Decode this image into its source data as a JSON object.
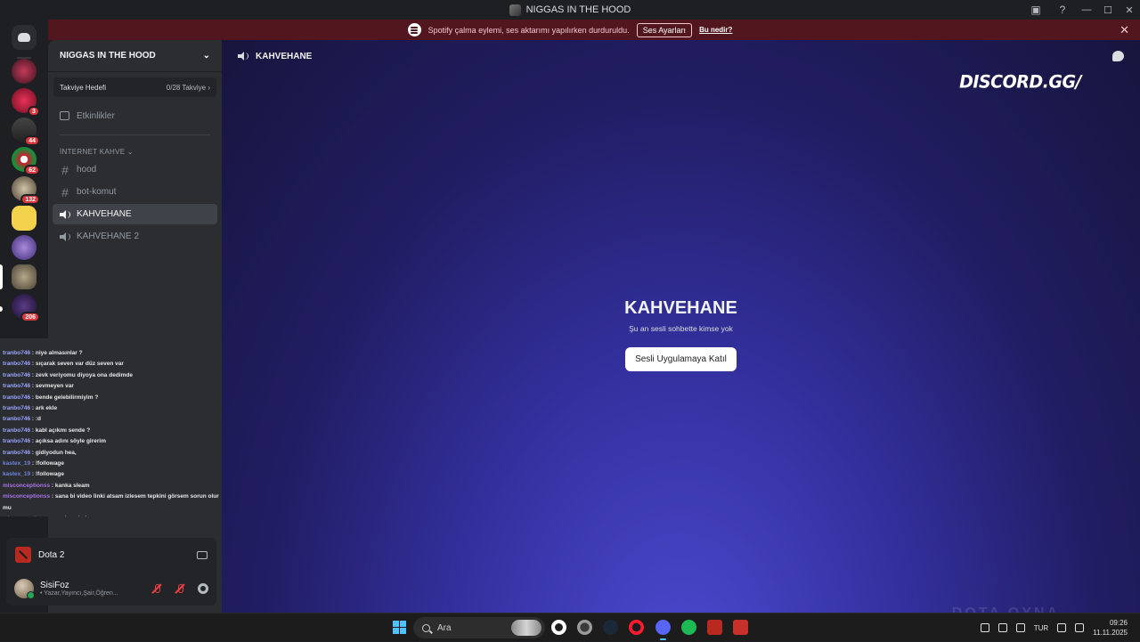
{
  "window": {
    "title": "NIGGAS IN THE HOOD",
    "controls": [
      "—",
      "☐",
      "✕"
    ]
  },
  "notice": {
    "text": "Spotify çalma eylemi, ses aktarımı yapılırken durduruldu.",
    "button": "Ses Ayarları",
    "link": "Bu nedir?"
  },
  "rail": {
    "badges": [
      "3",
      "44",
      "62",
      "132",
      "206"
    ]
  },
  "server": {
    "name": "NIGGAS IN THE HOOD",
    "boost_label": "Takviye Hedefi",
    "boost_progress": "0/28 Takviye",
    "events": "Etkinlikler",
    "category": "İNTERNET KAHVE",
    "channels": [
      {
        "name": "hood",
        "type": "text"
      },
      {
        "name": "bot-komut",
        "type": "text"
      },
      {
        "name": "KAHVEHANE",
        "type": "voice"
      },
      {
        "name": "KAHVEHANE 2",
        "type": "voice"
      }
    ]
  },
  "chat_overlay": [
    {
      "user": "tranbo746",
      "msg": ": niye almasınlar ?"
    },
    {
      "user": "tranbo746",
      "msg": ": sıçarak seven var düz seven var"
    },
    {
      "user": "tranbo746",
      "msg": ": zevk veriyomu diyoya ona dedimde"
    },
    {
      "user": "tranbo746",
      "msg": ": sevmeyen var"
    },
    {
      "user": "tranbo746",
      "msg": ": bende gelebilirmiyim ?"
    },
    {
      "user": "tranbo746",
      "msg": ": ark ekle"
    },
    {
      "user": "tranbo746",
      "msg": ": :d"
    },
    {
      "user": "tranbo746",
      "msg": ": kabl açıkmı sende ?"
    },
    {
      "user": "tranbo746",
      "msg": ": açıksa adını söyle girerim"
    },
    {
      "user": "tranbo746",
      "msg": ": gidiyodun hea,"
    },
    {
      "user": "kastex_19",
      "msg": ": !followage"
    },
    {
      "user": "kastex_19",
      "msg": ": !followage"
    },
    {
      "user": "misconceptionss",
      "msg": ": kanka sleam"
    },
    {
      "user": "misconceptionss",
      "msg": ": sana bi video linki atsam izlesem tepkini görsem sorun olur mu"
    },
    {
      "user": "misconceptionss",
      "msg": ": sesin gelmiyor"
    }
  ],
  "activity": {
    "game": "Dota 2"
  },
  "user": {
    "name": "SisiFoz",
    "status": "• Yazar,Yayıncı,Şair,Öğren..."
  },
  "main": {
    "channel": "KAHVEHANE",
    "watermark": "DISCORD.GG/",
    "empty_title": "KAHVEHANE",
    "empty_subtitle": "Şu an sesli sohbette kimse yok",
    "join_button": "Sesli Uygulamaya Katıl",
    "background_text": "DOTA OYNA"
  },
  "taskbar": {
    "search_placeholder": "Ara",
    "language": "TUR",
    "time": "09:26",
    "date": "11.11.2025"
  },
  "colors": {
    "accent": "#5865f2",
    "danger": "#da373c",
    "banner": "#52161f",
    "online": "#23a55a"
  }
}
